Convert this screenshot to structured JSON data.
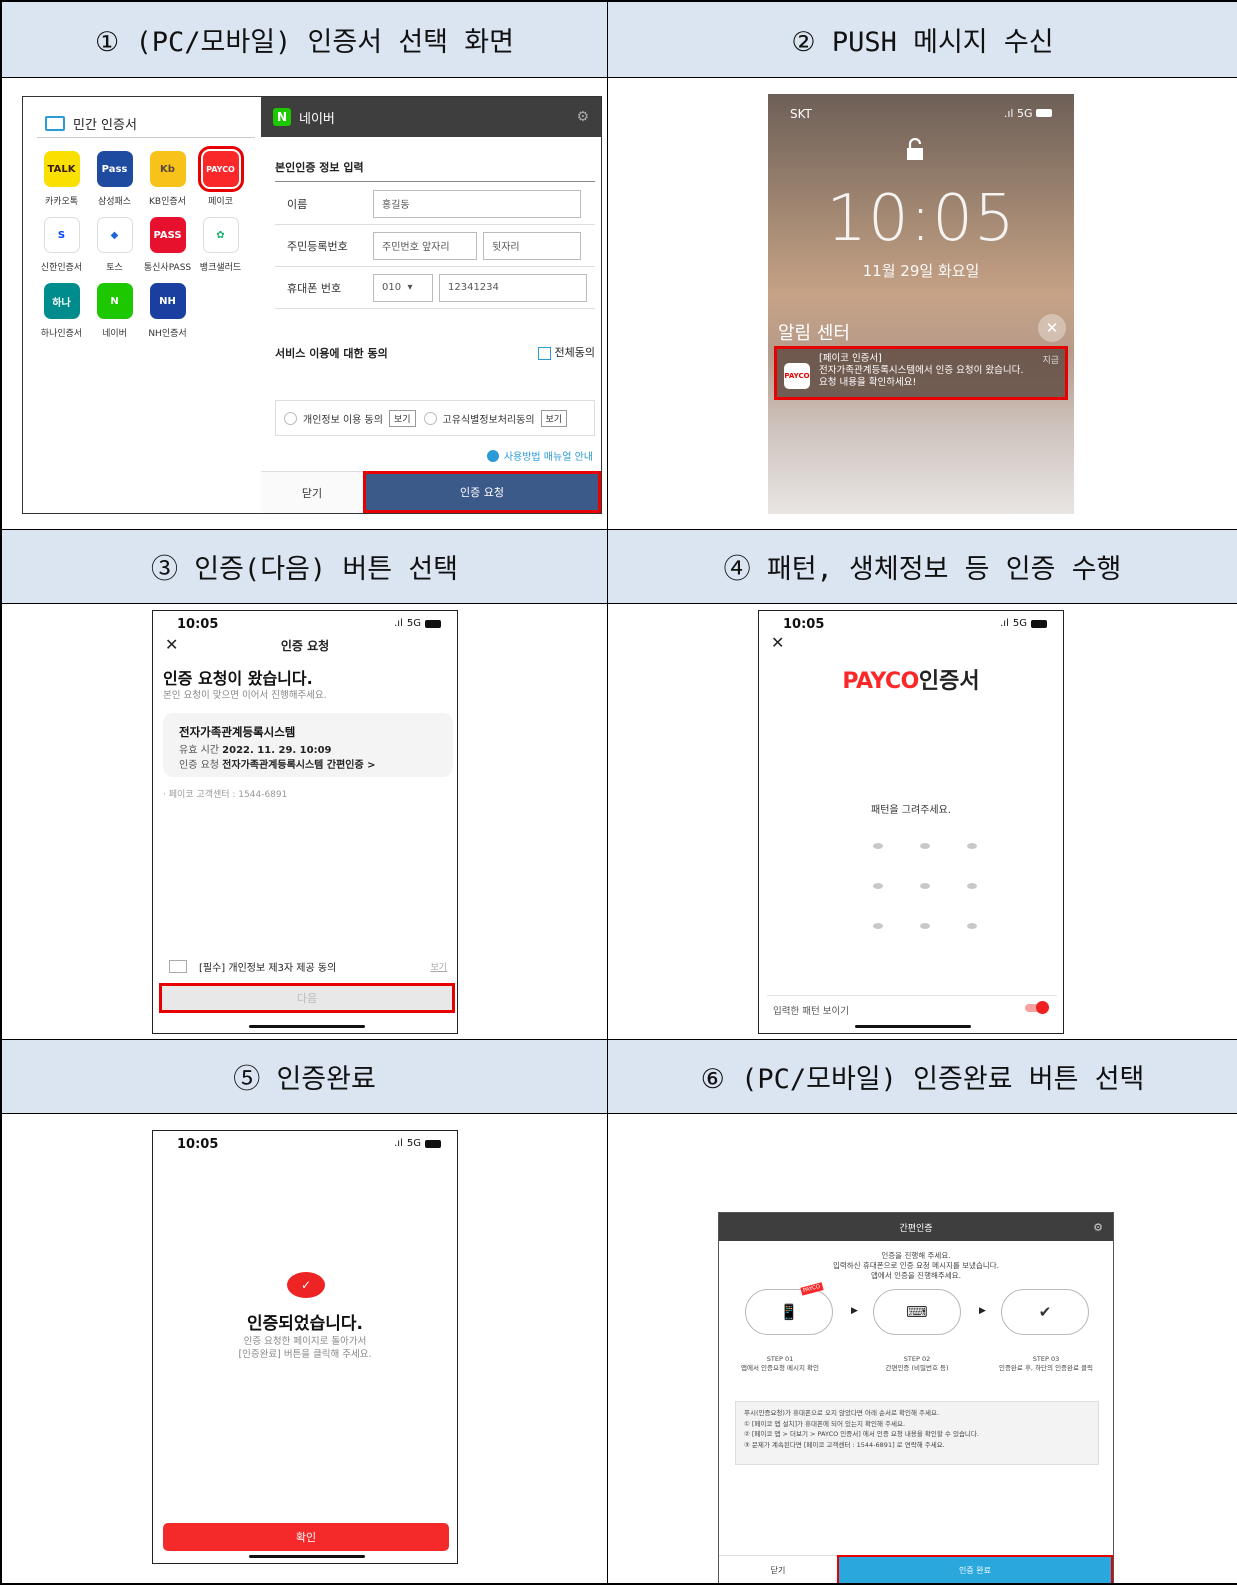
{
  "steps": [
    {
      "title": "① (PC/모바일) 인증서 선택 화면"
    },
    {
      "title": "② PUSH 메시지 수신"
    },
    {
      "title": "③ 인증(다음) 버튼 선택"
    },
    {
      "title": "④ 패턴, 생체정보 등 인증 수행"
    },
    {
      "title": "⑤ 인증완료"
    },
    {
      "title": "⑥ (PC/모바일) 인증완료 버튼 선택"
    }
  ],
  "panel1": {
    "left_title": "민간 인증서",
    "certs": [
      {
        "logo": "TALK",
        "label": "카카오톡",
        "bg": "#f9e000",
        "fg": "#3a1d1d"
      },
      {
        "logo": "Pass",
        "label": "삼성패스",
        "bg": "#1e4ba0",
        "fg": "#ffffff"
      },
      {
        "logo": "Kb",
        "label": "KB인증서",
        "bg": "#f7c21a",
        "fg": "#5a4a3a"
      },
      {
        "logo": "PAYCO",
        "label": "페이코",
        "bg": "#fa2828",
        "fg": "#ffffff"
      },
      {
        "logo": "S",
        "label": "신한인증서",
        "bg": "#ffffff",
        "fg": "#0046ff"
      },
      {
        "logo": "◆",
        "label": "토스",
        "bg": "#ffffff",
        "fg": "#1b64da"
      },
      {
        "logo": "PASS",
        "label": "통신사PASS",
        "bg": "#e8112d",
        "fg": "#ffffff"
      },
      {
        "logo": "✿",
        "label": "뱅크샐러드",
        "bg": "#ffffff",
        "fg": "#18b06a"
      },
      {
        "logo": "하나",
        "label": "하나인증서",
        "bg": "#008c8c",
        "fg": "#ffffff"
      },
      {
        "logo": "N",
        "label": "네이버",
        "bg": "#1ec800",
        "fg": "#ffffff"
      },
      {
        "logo": "NH",
        "label": "NH인증서",
        "bg": "#1a3fa0",
        "fg": "#ffffff"
      }
    ],
    "right_title": "네이버",
    "right_logo": "N",
    "section": "본인인증 정보 입력",
    "fields": {
      "name_label": "이름",
      "name_value": "홍길동",
      "rrn_label": "주민등록번호",
      "rrn_front": "주민번호 앞자리",
      "rrn_back": "뒷자리",
      "phone_label": "휴대폰 번호",
      "phone_prefix": "010",
      "phone_value": "12341234"
    },
    "consent_title": "서비스 이용에 대한 동의",
    "agree_all": "전체동의",
    "consent1": "개인정보 이용 동의",
    "consent2": "고유식별정보처리동의",
    "view": "보기",
    "manual": "사용방법 매뉴얼 안내",
    "close": "닫기",
    "request": "인증 요청"
  },
  "panel2": {
    "carrier": "SKT",
    "network": "5G",
    "time": "10:05",
    "date": "11월 29일 화요일",
    "notification_center": "알림 센터",
    "notif_app": "PAYCO",
    "notif_title": "[페이코 인증서]",
    "notif_line1": "전자가족관계등록시스템에서 인증 요청이 왔습니다.",
    "notif_line2": "요청 내용을 확인하세요!",
    "notif_time": "지금"
  },
  "phone_status": {
    "time": "10:05",
    "network": "5G"
  },
  "panel3": {
    "header": "인증 요청",
    "headline": "인증 요청이 왔습니다.",
    "subline": "본인 요청이 맞으면 이어서 진행해주세요.",
    "card_title": "전자가족관계등록시스템",
    "valid_label": "유효 시간",
    "valid_value": "2022. 11. 29. 10:09",
    "req_label": "인증 요청",
    "req_value": "전자가족관계등록시스템 간편인증 >",
    "cs": "· 페이코 고객센터 : 1544-6891",
    "agree": "[필수] 개인정보 제3자 제공 동의",
    "agree_view": "보기",
    "next": "다음"
  },
  "panel4": {
    "brand_a": "PAYCO",
    "brand_b": "인증서",
    "message": "패턴을 그려주세요.",
    "show_pattern": "입력한 패턴 보이기",
    "toggle_on": true
  },
  "panel5": {
    "done": "인증되었습니다.",
    "sub1": "인증 요청한 페이지로 돌아가서",
    "sub2": "[인증완료] 버튼을 클릭해 주세요.",
    "ok": "확인"
  },
  "panel6": {
    "title": "간편인증",
    "intro1": "인증을 진행해 주세요.",
    "intro2": "입력하신 휴대폰으로 인증 요청 메시지를 보냈습니다.",
    "intro3": "앱에서 인증을 진행해주세요.",
    "payco_tag": "PAYCO",
    "step1_no": "STEP 01",
    "step1": "앱에서 인증요청 메시지 확인",
    "step2_no": "STEP 02",
    "step2": "간편인증 (비밀번호 등)",
    "step3_no": "STEP 03",
    "step3": "인증완료 후, 하단의 인증완료 클릭",
    "note0": "푸시(인증요청)가 휴대폰으로 오지 않았다면 아래 순서로 확인해 주세요.",
    "note1": "① [페이코 앱 설치]가 휴대폰에 되어 있는지 확인해 주세요.",
    "note2": "② [페이코 앱 > 더보기 > PAYCO 인증서] 에서 인증 요청 내용을 확인할 수 있습니다.",
    "note3": "③ 문제가 계속된다면 [페이코 고객센터 : 1544-6891] 로 연락해 주세요.",
    "close": "닫기",
    "complete": "인증 완료"
  }
}
